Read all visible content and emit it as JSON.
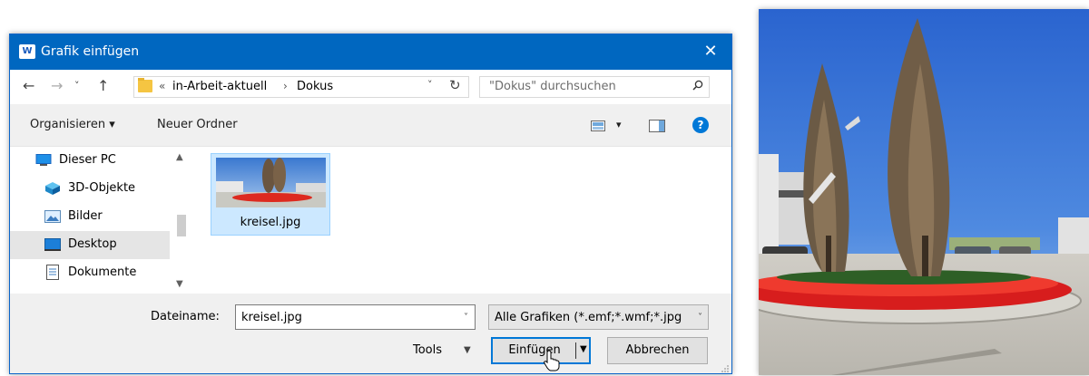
{
  "dialog": {
    "title": "Grafik einfügen",
    "app_icon_label": "W",
    "close_glyph": "✕"
  },
  "address": {
    "back": "←",
    "forward": "→",
    "recent": "˅",
    "up": "↑",
    "overflow": "«",
    "crumbs": [
      "in-Arbeit-aktuell",
      "Dokus"
    ],
    "separator": "›",
    "dropdown": "˅",
    "refresh": "↻"
  },
  "search": {
    "placeholder": "\"Dokus\" durchsuchen"
  },
  "toolbar": {
    "organize_label": "Organisieren ▾",
    "new_folder_label": "Neuer Ordner",
    "view_dropdown": "▾",
    "help": "?"
  },
  "nav": {
    "items": [
      {
        "label": "Dieser PC",
        "icon": "pc-icon"
      },
      {
        "label": "3D-Objekte",
        "icon": "3d-objects-icon"
      },
      {
        "label": "Bilder",
        "icon": "pictures-icon"
      },
      {
        "label": "Desktop",
        "icon": "desktop-icon",
        "selected": true
      },
      {
        "label": "Dokumente",
        "icon": "documents-icon"
      }
    ],
    "scroll_up": "▲",
    "scroll_down": "▼"
  },
  "files": [
    {
      "name": "kreisel.jpg",
      "selected": true
    }
  ],
  "bottom": {
    "filename_label": "Dateiname:",
    "filename_value": "kreisel.jpg",
    "filename_dropdown": "˅",
    "filter_value": "Alle Grafiken (*.emf;*.wmf;*.jpg",
    "filter_dropdown": "˅",
    "tools_label": "Tools",
    "tools_dropdown": "▼",
    "insert_label": "Einfügen",
    "insert_dropdown": "▼",
    "cancel_label": "Abbrechen"
  },
  "colors": {
    "titlebar": "#0067c0",
    "selection": "#cce8ff",
    "accent": "#0078d7",
    "tulips": "#e0201e",
    "sky": "#2f6fd6"
  }
}
